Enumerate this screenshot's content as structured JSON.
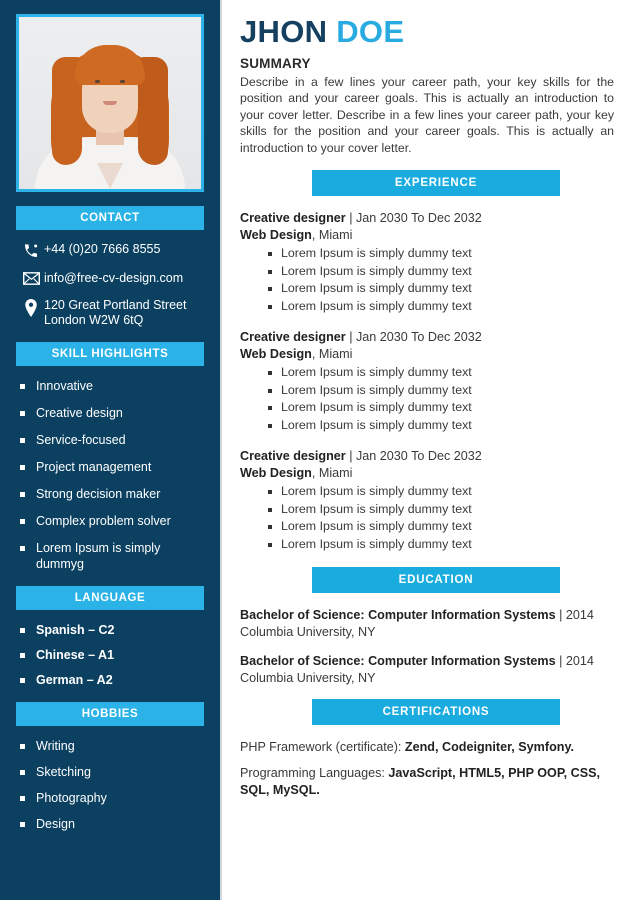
{
  "header": {
    "first_name": "JHON",
    "last_name": "DOE",
    "summary_heading": "SUMMARY",
    "summary_text": "Describe in a few lines your career path, your key skills for the position and your career goals. This is actually an introduction to your cover letter. Describe in a few lines your career path, your key skills for the position and your career goals. This is actually an introduction to your cover letter."
  },
  "colors": {
    "sidebar_navy": "#0b4061",
    "accent_cyan": "#2bb3e8",
    "name_dark": "#15405f",
    "name_accent": "#29abe2"
  },
  "sidebar": {
    "contact": {
      "title": "CONTACT",
      "phone": "+44 (0)20 7666 8555",
      "email": "info@free-cv-design.com",
      "address_line1": "120 Great Portland Street",
      "address_line2": "London W2W 6tQ"
    },
    "skills": {
      "title": "SKILL HIGHLIGHTS",
      "items": [
        "Innovative",
        "Creative design",
        "Service-focused",
        "Project management",
        "Strong decision maker",
        "Complex problem solver",
        "Lorem Ipsum is simply dummyg"
      ]
    },
    "language": {
      "title": "LANGUAGE",
      "items": [
        "Spanish – C2",
        "Chinese – A1",
        "German – A2"
      ]
    },
    "hobbies": {
      "title": "HOBBIES",
      "items": [
        "Writing",
        "Sketching",
        "Photography",
        "Design"
      ]
    }
  },
  "main": {
    "experience": {
      "title": "EXPERIENCE",
      "jobs": [
        {
          "role": "Creative designer",
          "separator": " | ",
          "dates": "Jan 2030 To Dec 2032",
          "company": "Web Design",
          "location": ", Miami",
          "bullets": [
            "Lorem Ipsum is simply dummy text",
            "Lorem Ipsum is simply dummy text",
            "Lorem Ipsum is simply dummy text",
            "Lorem Ipsum is simply dummy text"
          ]
        },
        {
          "role": "Creative designer",
          "separator": " | ",
          "dates": "Jan 2030 To Dec 2032",
          "company": "Web Design",
          "location": ", Miami",
          "bullets": [
            "Lorem Ipsum is simply dummy text",
            "Lorem Ipsum is simply dummy text",
            "Lorem Ipsum is simply dummy text",
            "Lorem Ipsum is simply dummy text"
          ]
        },
        {
          "role": "Creative designer",
          "separator": " | ",
          "dates": "Jan 2030 To Dec 2032",
          "company": "Web Design",
          "location": ", Miami",
          "bullets": [
            "Lorem Ipsum is simply dummy text",
            "Lorem Ipsum is simply dummy text",
            "Lorem Ipsum is simply dummy text",
            "Lorem Ipsum is simply dummy text"
          ]
        }
      ]
    },
    "education": {
      "title": "EDUCATION",
      "entries": [
        {
          "degree": "Bachelor of Science: Computer Information Systems",
          "separator": " | ",
          "year": "2014",
          "school": "Columbia University, NY"
        },
        {
          "degree": "Bachelor of Science: Computer Information Systems",
          "separator": " | ",
          "year": "2014",
          "school": "Columbia University, NY"
        }
      ]
    },
    "certifications": {
      "title": "CERTIFICATIONS",
      "entries": [
        {
          "label": "PHP Framework (certificate): ",
          "value": "Zend, Codeigniter, Symfony."
        },
        {
          "label": "Programming Languages: ",
          "value": "JavaScript, HTML5, PHP OOP, CSS, SQL, MySQL."
        }
      ]
    }
  }
}
